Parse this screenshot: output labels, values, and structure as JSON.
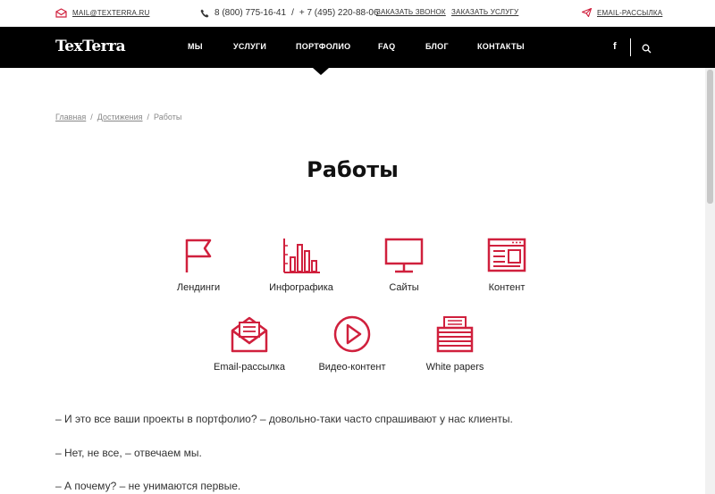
{
  "topbar": {
    "email": "MAIL@TEXTERRA.RU",
    "phone_main": "8 (800) 775-16-41",
    "phone_sep": "/",
    "phone_alt": "+ 7 (495) 220-88-06",
    "callback": "ЗАКАЗАТЬ ЗВОНОК",
    "order_service": "ЗАКАЗАТЬ УСЛУГУ",
    "newsletter": "EMAIL-РАССЫЛКА"
  },
  "nav": {
    "logo": "TexTerra",
    "items": [
      "МЫ",
      "УСЛУГИ",
      "ПОРТФОЛИО",
      "FAQ",
      "БЛОГ",
      "КОНТАКТЫ"
    ],
    "active": "ПОРТФОЛИО",
    "facebook": "f"
  },
  "breadcrumb": {
    "home": "Главная",
    "achievements": "Достижения",
    "current": "Работы",
    "sep": "/"
  },
  "title": "Работы",
  "tiles": [
    {
      "label": "Лендинги",
      "icon": "flag-icon"
    },
    {
      "label": "Инфографика",
      "icon": "bar-chart-icon"
    },
    {
      "label": "Сайты",
      "icon": "monitor-icon"
    },
    {
      "label": "Контент",
      "icon": "content-window-icon"
    },
    {
      "label": "Email-рассылка",
      "icon": "envelope-icon"
    },
    {
      "label": "Видео-контент",
      "icon": "play-circle-icon"
    },
    {
      "label": "White papers",
      "icon": "paper-stack-icon"
    }
  ],
  "paragraphs": [
    "– И это все ваши проекты в портфолио? – довольно-таки часто спрашивают у нас клиенты.",
    "– Нет, не все, – отвечаем мы.",
    "– А почему? – не унимаются первые."
  ],
  "colors": {
    "accent": "#d0203d",
    "nav_bg": "#000000",
    "text": "#222222"
  }
}
